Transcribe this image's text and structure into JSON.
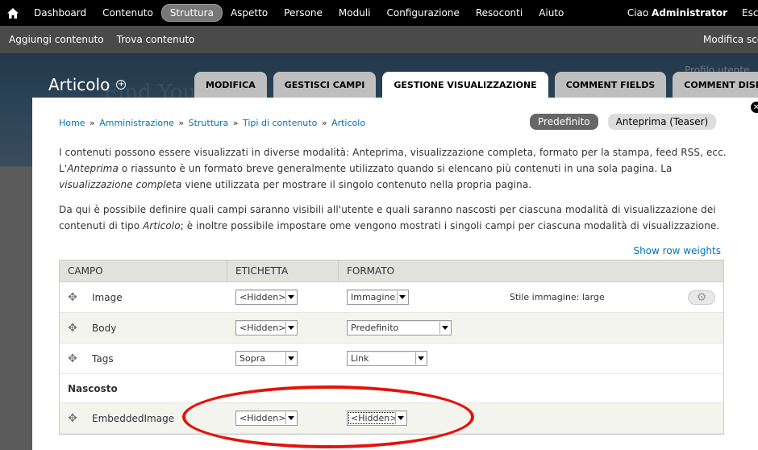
{
  "toolbar": {
    "menu": [
      "Dashboard",
      "Contenuto",
      "Struttura",
      "Aspetto",
      "Persone",
      "Moduli",
      "Configurazione",
      "Resoconti",
      "Aiuto"
    ],
    "active_index": 2,
    "greeting_prefix": "Ciao ",
    "user": "Administrator",
    "logout": "Esci"
  },
  "shortcuts": {
    "items": [
      "Aggiungi contenuto",
      "Trova contenuto"
    ],
    "edit": "Modifica scorciatoie"
  },
  "background": {
    "ghost_title": "Find Your",
    "ghost_link": "Profilo utente"
  },
  "page": {
    "title": "Articolo",
    "tabs": [
      "MODIFICA",
      "GESTISCI CAMPI",
      "GESTIONE VISUALIZZAZIONE",
      "COMMENT FIELDS",
      "COMMENT DISPLAY"
    ],
    "active_tab": 2
  },
  "breadcrumb": {
    "items": [
      "Home",
      "Amministrazione",
      "Struttura",
      "Tipi di contenuto",
      "Articolo"
    ],
    "separator": "»"
  },
  "view_modes": {
    "items": [
      "Predefinito",
      "Anteprima (Teaser)"
    ],
    "active_index": 0
  },
  "description": {
    "p1_a": "I contenuti possono essere visualizzati in diverse modalità: Anteprima, visualizzazione completa, formato per la stampa, feed RSS, ecc. L'",
    "p1_em1": "Anteprima",
    "p1_b": " o riassunto è un formato breve generalmente utilizzato quando si elencano più contenuti in una sola pagina. La ",
    "p1_em2": "visualizzazione completa",
    "p1_c": " viene utilizzata per mostrare il singolo contenuto nella propria pagina.",
    "p2_a": "Da qui è possibile definire quali campi saranno visibili all'utente e quali saranno nascosti per ciascuna modalità di visualizzazione dei contenuti di tipo ",
    "p2_em": "Articolo",
    "p2_b": "; è inoltre possibile impostare ome vengono mostrati i singoli campi per ciascuna modalità di visualizzazione."
  },
  "row_weights_link": "Show row weights",
  "table": {
    "headers": [
      "CAMPO",
      "ETICHETTA",
      "FORMATO"
    ],
    "rows": [
      {
        "name": "Image",
        "label": "<Hidden>",
        "format": "Immagine",
        "summary": "Stile immagine: large"
      },
      {
        "name": "Body",
        "label": "<Hidden>",
        "format": "Predefinito",
        "summary": ""
      },
      {
        "name": "Tags",
        "label": "Sopra",
        "format": "Link",
        "summary": ""
      }
    ],
    "hidden_section": "Nascosto",
    "hidden_rows": [
      {
        "name": "EmbeddedImage",
        "label": "<Hidden>",
        "format": "<Hidden>"
      }
    ]
  },
  "colors": {
    "link": "#0074bd",
    "annotation": "#e3120b"
  }
}
